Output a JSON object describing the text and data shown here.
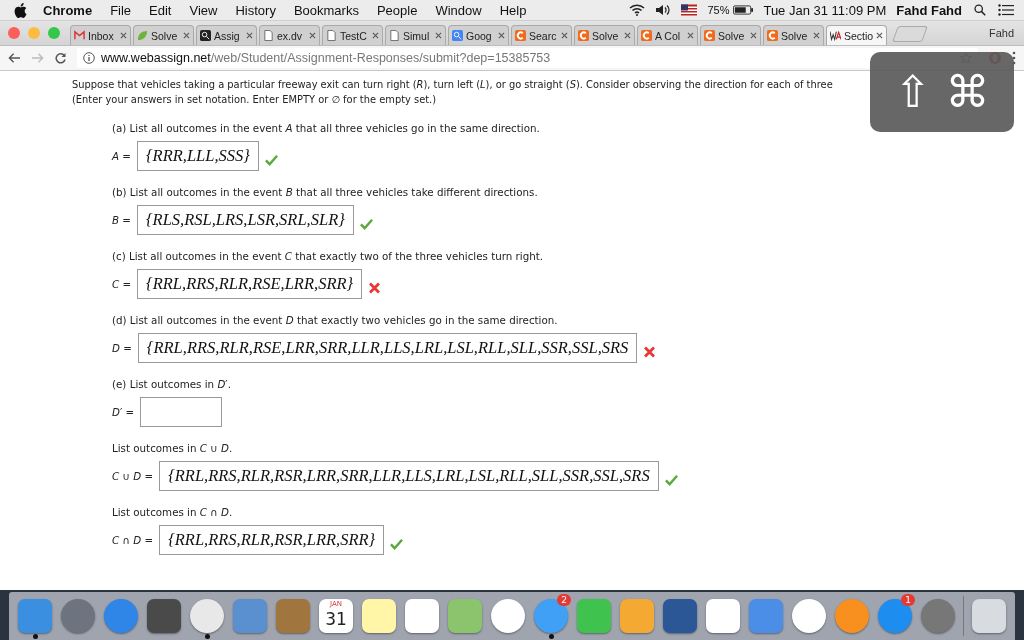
{
  "menu_bar": {
    "app": "Chrome",
    "items": [
      "File",
      "Edit",
      "View",
      "History",
      "Bookmarks",
      "People",
      "Window",
      "Help"
    ],
    "battery": "75%",
    "clock": "Tue Jan 31  11:09 PM",
    "user": "Fahd Fahd"
  },
  "tabs": [
    {
      "title": "Inbox",
      "kind": "mail",
      "selected": false
    },
    {
      "title": "Solve",
      "kind": "leaf",
      "selected": false
    },
    {
      "title": "Assig",
      "kind": "bb",
      "selected": false
    },
    {
      "title": "ex.dv",
      "kind": "doc",
      "selected": false
    },
    {
      "title": "TestC",
      "kind": "doc",
      "selected": false
    },
    {
      "title": "Simul",
      "kind": "doc",
      "selected": false
    },
    {
      "title": "Goog",
      "kind": "google",
      "selected": false
    },
    {
      "title": "Searc",
      "kind": "c",
      "selected": false
    },
    {
      "title": "Solve",
      "kind": "c",
      "selected": false
    },
    {
      "title": "A Col",
      "kind": "c",
      "selected": false
    },
    {
      "title": "Solve",
      "kind": "c",
      "selected": false
    },
    {
      "title": "Solve",
      "kind": "c",
      "selected": false
    },
    {
      "title": "Sectio",
      "kind": "wa",
      "selected": true
    }
  ],
  "profile": "Fahd",
  "address_bar": {
    "url": "**www.webassign.net**/web/Student/Assignment-Responses/submit?dep=15385753"
  },
  "shortcut_hud": {
    "keys": [
      "⇧",
      "⌘"
    ]
  },
  "question": {
    "intro": [
      "Suppose that vehicles taking a particular freeway exit can turn right (*R*), turn left (*L*), or go straight (*S*). Consider observing the direction for each of three",
      "(Enter your answers in set notation. Enter EMPTY or ∅ for the empty set.)"
    ],
    "parts": [
      {
        "prompt": "(a) List all outcomes in the event *A* that all three vehicles go in the same direction.",
        "label": "*A* =",
        "value": "{RRR,LLL,SSS}",
        "correct": true
      },
      {
        "prompt": "(b) List all outcomes in the event *B* that all three vehicles take different directions.",
        "label": "*B* =",
        "value": "{RLS,RSL,LRS,LSR,SRL,SLR}",
        "correct": true
      },
      {
        "prompt": "(c) List all outcomes in the event *C* that exactly two of the three vehicles turn right.",
        "label": "*C* =",
        "value": "{RRL,RRS,RLR,RSE,LRR,SRR}",
        "correct": false
      },
      {
        "prompt": "(d) List all outcomes in the event *D* that exactly two vehicles go in the same direction.",
        "label": "*D* =",
        "value": "{RRL,RRS,RLR,RSE,LRR,SRR,LLR,LLS,LRL,LSL,RLL,SLL,SSR,SSL,SRS",
        "correct": false
      },
      {
        "prompt": "(e) List outcomes in *D*′.",
        "label": "*D*′ ="
      },
      {
        "prompt": "List outcomes in *C* ∪ *D*.",
        "label": "*C* ∪ *D* =",
        "value": "{RRL,RRS,RLR,RSR,LRR,SRR,LLR,LLS,LRL,LSL,RLL,SLL,SSR,SSL,SRS",
        "correct": true
      },
      {
        "prompt": "List outcomes in *C* ∩ *D*.",
        "label": "*C* ∩ *D* =",
        "value": "{RRL,RRS,RLR,RSR,LRR,SRR}",
        "correct": true
      }
    ]
  },
  "dock": [
    {
      "kind": "finder",
      "running": true
    },
    {
      "kind": "rocket",
      "running": false
    },
    {
      "kind": "compass",
      "running": false
    },
    {
      "kind": "sublime",
      "running": false
    },
    {
      "kind": "chrome",
      "running": true
    },
    {
      "kind": "mail",
      "running": false
    },
    {
      "kind": "contacts",
      "running": false
    },
    {
      "kind": "calendar",
      "month": "JAN",
      "day": "31",
      "running": false
    },
    {
      "kind": "notes",
      "running": false
    },
    {
      "kind": "reminders",
      "running": false
    },
    {
      "kind": "maps",
      "running": false
    },
    {
      "kind": "photos",
      "running": false
    },
    {
      "kind": "messages",
      "badge": "2",
      "running": true
    },
    {
      "kind": "facetime",
      "running": false
    },
    {
      "kind": "pages",
      "running": false
    },
    {
      "kind": "word",
      "running": false
    },
    {
      "kind": "numbers",
      "running": false
    },
    {
      "kind": "keynote",
      "running": false
    },
    {
      "kind": "music",
      "running": false
    },
    {
      "kind": "books",
      "running": false
    },
    {
      "kind": "appstore",
      "badge": "1",
      "running": false
    },
    {
      "kind": "preferences",
      "running": false
    },
    {
      "kind": "separator"
    },
    {
      "kind": "trash",
      "running": false
    }
  ]
}
